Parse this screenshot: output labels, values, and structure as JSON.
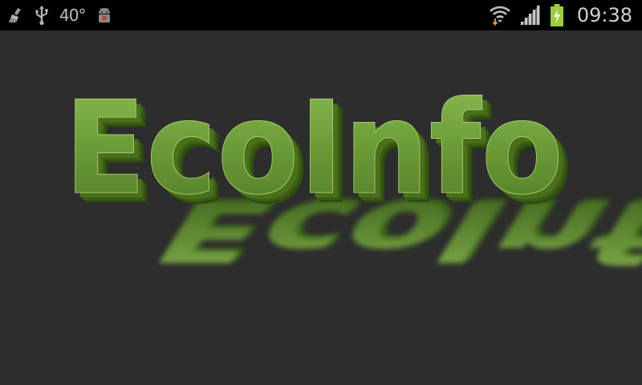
{
  "status_bar": {
    "icons_left": [
      "cleaner-broom-icon",
      "usb-icon",
      "temperature-readout",
      "android-debug-icon"
    ],
    "temperature": "40°",
    "icons_right": [
      "wifi-signal-icon",
      "cell-signal-icon",
      "battery-charging-icon"
    ],
    "time": "09:38"
  },
  "splash": {
    "logo_text": "EcoInfo",
    "colors": {
      "logo_light": "#86b54a",
      "logo_mid": "#6a9a34",
      "logo_dark": "#3c5e14",
      "background": "#2d2d2d"
    }
  }
}
